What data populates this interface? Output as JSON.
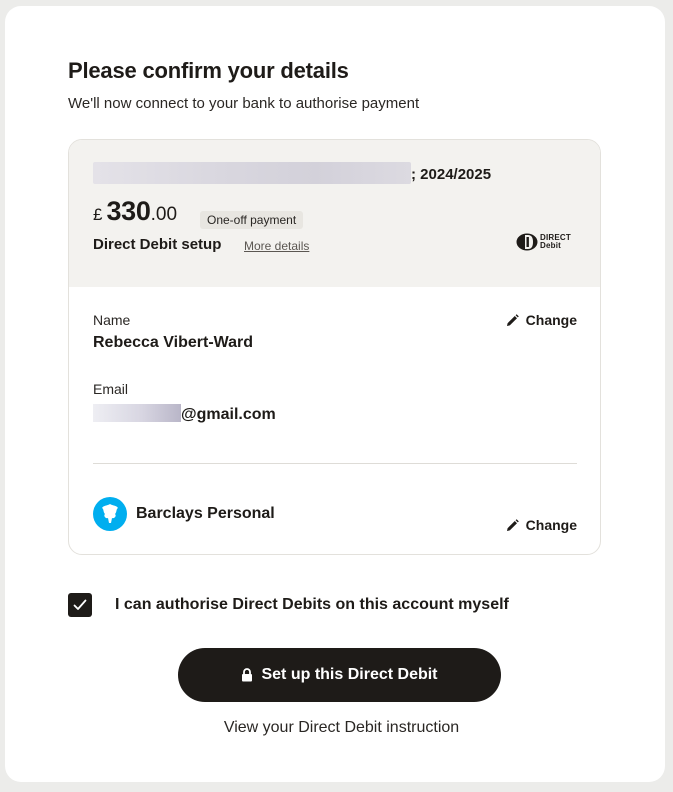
{
  "page": {
    "title": "Please confirm your details",
    "subtitle": "We'll now connect to your bank to authorise payment"
  },
  "payment": {
    "reference_suffix": "; 2024/2025",
    "currency_symbol": "£",
    "amount_whole": "330",
    "amount_decimal": ".00",
    "payment_type_badge": "One-off payment",
    "setup_label": "Direct Debit setup",
    "more_details_link": "More details",
    "logo_text_line1": "DIRECT",
    "logo_text_line2": "Debit"
  },
  "payer": {
    "name_label": "Name",
    "name_value": "Rebecca Vibert-Ward",
    "email_label": "Email",
    "email_domain": "@gmail.com",
    "change_label": "Change"
  },
  "bank": {
    "name": "Barclays Personal",
    "change_label": "Change",
    "logo_color": "#00aeef",
    "logo_icon": "eagle-icon"
  },
  "authorise": {
    "checked": true,
    "label": "I can authorise Direct Debits on this account myself"
  },
  "actions": {
    "primary_label": "Set up this Direct Debit",
    "instruction_link": "View your Direct Debit instruction"
  }
}
